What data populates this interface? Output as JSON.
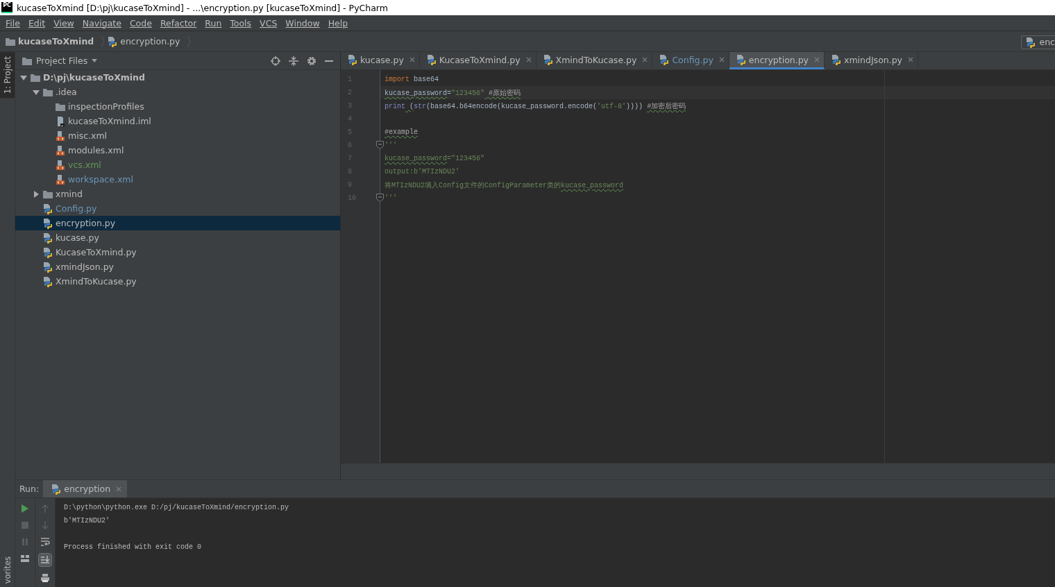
{
  "window": {
    "app_icon": "PC",
    "title": "kucaseToXmind [D:\\pj\\kucaseToXmind] - ...\\encryption.py [kucaseToXmind] - PyCharm"
  },
  "menu": [
    "File",
    "Edit",
    "View",
    "Navigate",
    "Code",
    "Refactor",
    "Run",
    "Tools",
    "VCS",
    "Window",
    "Help"
  ],
  "breadcrumbs": [
    {
      "label": "kucaseToXmind",
      "kind": "folder"
    },
    {
      "label": "encryption.py",
      "kind": "py"
    }
  ],
  "run_config": {
    "label": "enc"
  },
  "tool_strip": [
    {
      "label": "1: Project",
      "selected": true
    },
    {
      "label": "vorites",
      "selected": false
    }
  ],
  "project": {
    "title": "Project Files",
    "tree": [
      {
        "label": "D:\\pj\\kucaseToXmind",
        "kind": "root",
        "expanded": true,
        "selected": false,
        "color": "#bbbbbb",
        "children": [
          {
            "label": ".idea",
            "kind": "folder",
            "expanded": true,
            "selected": false,
            "color": "#bbbbbb",
            "children": [
              {
                "label": "inspectionProfiles",
                "kind": "folder",
                "selected": false,
                "color": "#bbbbbb"
              },
              {
                "label": "kucaseToXmind.iml",
                "kind": "iml",
                "selected": false,
                "color": "#bbbbbb"
              },
              {
                "label": "misc.xml",
                "kind": "xml",
                "selected": false,
                "color": "#bbbbbb"
              },
              {
                "label": "modules.xml",
                "kind": "xml",
                "selected": false,
                "color": "#bbbbbb"
              },
              {
                "label": "vcs.xml",
                "kind": "xml",
                "selected": false,
                "color": "#629755"
              },
              {
                "label": "workspace.xml",
                "kind": "xml",
                "selected": false,
                "color": "#6897bb"
              }
            ]
          },
          {
            "label": "xmind",
            "kind": "folder",
            "expanded": false,
            "selected": false,
            "color": "#bbbbbb"
          },
          {
            "label": "Config.py",
            "kind": "py",
            "selected": false,
            "color": "#6897bb"
          },
          {
            "label": "encryption.py",
            "kind": "py",
            "selected": true,
            "color": "#bbbbbb"
          },
          {
            "label": "kucase.py",
            "kind": "py",
            "selected": false,
            "color": "#bbbbbb"
          },
          {
            "label": "KucaseToXmind.py",
            "kind": "py",
            "selected": false,
            "color": "#bbbbbb"
          },
          {
            "label": "xmindJson.py",
            "kind": "py",
            "selected": false,
            "color": "#bbbbbb"
          },
          {
            "label": "XmindToKucase.py",
            "kind": "py",
            "selected": false,
            "color": "#bbbbbb"
          }
        ]
      }
    ]
  },
  "editor_tabs": [
    {
      "label": "kucase.py",
      "selected": false,
      "color": "#bbbbbb"
    },
    {
      "label": "KucaseToXmind.py",
      "selected": false,
      "color": "#bbbbbb"
    },
    {
      "label": "XmindToKucase.py",
      "selected": false,
      "color": "#bbbbbb"
    },
    {
      "label": "Config.py",
      "selected": false,
      "color": "#6897bb"
    },
    {
      "label": "encryption.py",
      "selected": true,
      "color": "#bbbbbb"
    },
    {
      "label": "xmindJson.py",
      "selected": false,
      "color": "#bbbbbb"
    }
  ],
  "code": [
    {
      "number": "1",
      "current": false,
      "fold": false,
      "tokens": [
        {
          "text": "import",
          "kind": "keyword"
        },
        {
          "text": " base64",
          "kind": "plain"
        }
      ]
    },
    {
      "number": "2",
      "current": true,
      "fold": false,
      "tokens": [
        {
          "text": "kucase_password",
          "kind": "plain",
          "typo": true
        },
        {
          "text": "=",
          "kind": "plain"
        },
        {
          "text": "\"123456\"",
          "kind": "string"
        },
        {
          "text": " #原始密码",
          "kind": "comment",
          "typo": true
        }
      ]
    },
    {
      "number": "3",
      "current": false,
      "fold": false,
      "tokens": [
        {
          "text": "print",
          "kind": "builtin"
        },
        {
          "text": " (",
          "kind": "plain",
          "typo": true
        },
        {
          "text": "str",
          "kind": "builtin"
        },
        {
          "text": "(base64.b64encode(kucase_password.encode(",
          "kind": "plain"
        },
        {
          "text": "'utf-8'",
          "kind": "string"
        },
        {
          "text": ")))) ",
          "kind": "plain"
        },
        {
          "text": "#加密后密码",
          "kind": "comment",
          "typo": true
        }
      ]
    },
    {
      "number": "4",
      "current": false,
      "fold": false
    },
    {
      "number": "5",
      "current": false,
      "fold": false,
      "tokens": [
        {
          "text": "#example",
          "kind": "comment",
          "typo": true
        }
      ]
    },
    {
      "number": "6",
      "current": false,
      "fold": true,
      "tokens": [
        {
          "text": "'''",
          "kind": "string"
        }
      ]
    },
    {
      "number": "7",
      "current": false,
      "fold": false,
      "tokens": [
        {
          "text": "kucase_password",
          "kind": "string",
          "typo": true
        },
        {
          "text": "=\"123456\"",
          "kind": "string"
        }
      ]
    },
    {
      "number": "8",
      "current": false,
      "fold": false,
      "tokens": [
        {
          "text": "output:b'MTIzNDU2'",
          "kind": "string"
        }
      ]
    },
    {
      "number": "9",
      "current": false,
      "fold": false,
      "tokens": [
        {
          "text": "将MTIzNDU2填入Config文件的ConfigParameter类的",
          "kind": "string"
        },
        {
          "text": "kucase_password",
          "kind": "string",
          "typo": true
        }
      ]
    },
    {
      "number": "10",
      "current": false,
      "fold": true,
      "tokens": [
        {
          "text": "'''",
          "kind": "string"
        }
      ]
    }
  ],
  "run": {
    "label": "Run:",
    "tab": {
      "label": "encryption",
      "selected": true
    },
    "output": [
      {
        "text": "D:\\python\\python.exe D:/pj/kucaseToXmind/encryption.py",
        "kind": "command"
      },
      {
        "text": "b'MTIzNDU2'",
        "kind": "output"
      },
      {
        "text": "Process finished with exit code 0",
        "kind": "exit"
      }
    ]
  }
}
